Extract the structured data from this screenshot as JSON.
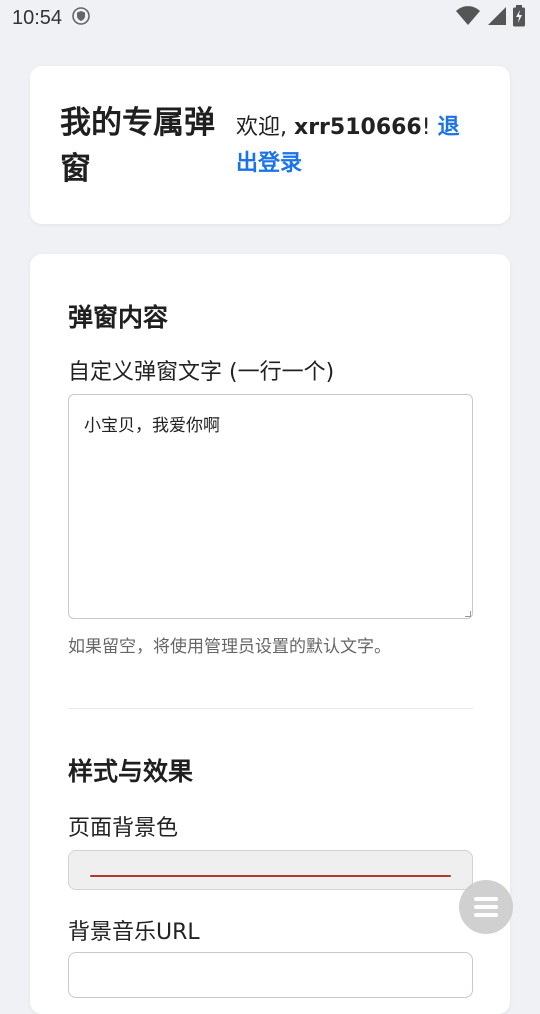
{
  "status_bar": {
    "time": "10:54",
    "icons": [
      "shield-icon",
      "wifi-icon",
      "signal-icon",
      "battery-charging-icon"
    ]
  },
  "header": {
    "title": "我的专属弹窗",
    "welcome_prefix": "欢迎, ",
    "username": "xrr510666",
    "welcome_suffix": "! ",
    "logout_label": "退出登录"
  },
  "content_section": {
    "title": "弹窗内容",
    "field_label": "自定义弹窗文字 (一行一个)",
    "field_value": "小宝贝，我爱你啊",
    "hint": "如果留空，将使用管理员设置的默认文字。"
  },
  "style_section": {
    "title": "样式与效果",
    "bg_color_label": "页面背景色",
    "bg_color_value": "#b03a2e",
    "music_url_label": "背景音乐URL",
    "music_url_value": ""
  },
  "colors": {
    "accent": "#1a73e8",
    "page_bg": "#f0f1f5",
    "card_bg": "#ffffff"
  },
  "floating_button": {
    "icon": "menu-icon"
  }
}
